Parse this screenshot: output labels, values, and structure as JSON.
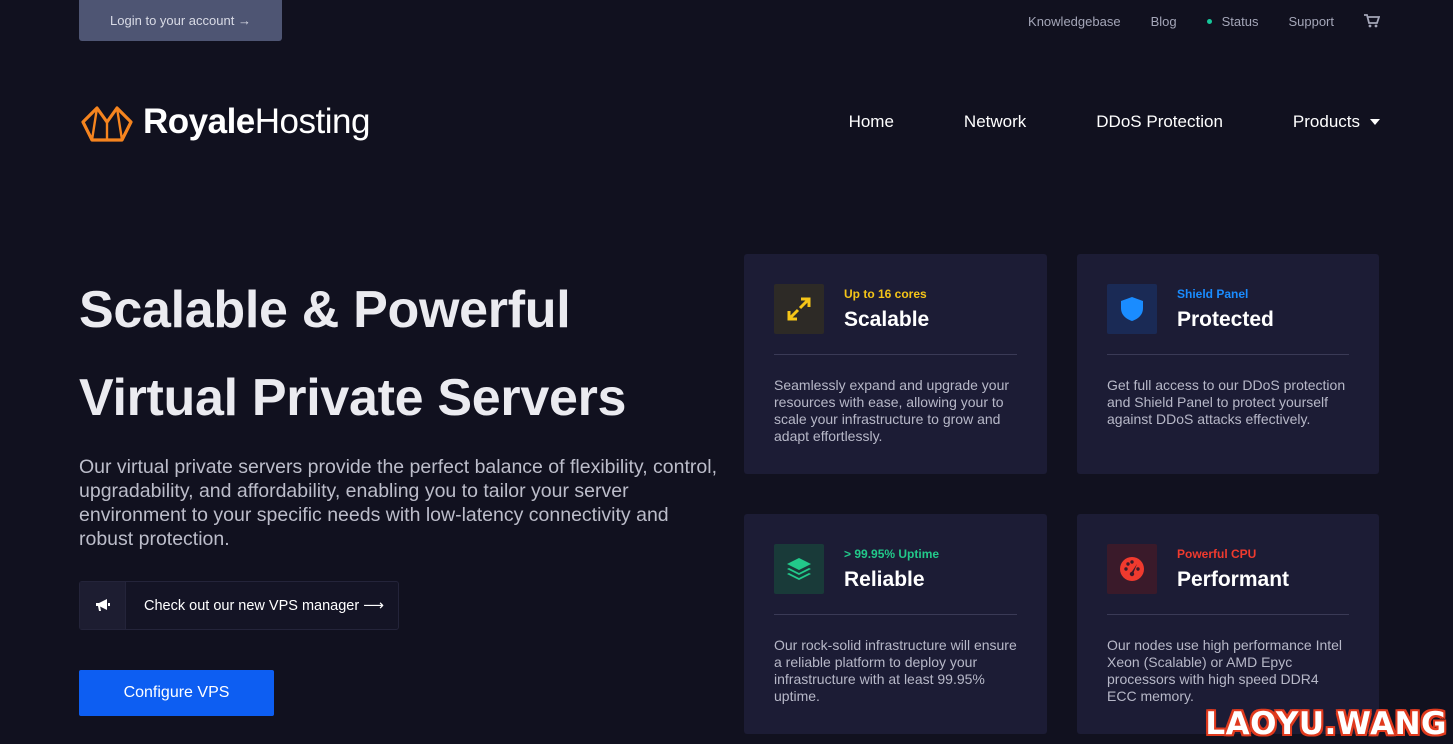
{
  "top_bar": {
    "login_label": "Login to your account →",
    "links": [
      "Knowledgebase",
      "Blog",
      "Status",
      "Support"
    ],
    "status_color": "#16c79a",
    "cart_icon": "cart-icon"
  },
  "header": {
    "logo_bold": "Royale",
    "logo_regular": "Hosting",
    "logo_icon": "crown-logo",
    "brand_color": "#f5841f",
    "nav": [
      "Home",
      "Network",
      "DDoS Protection",
      "Products"
    ]
  },
  "hero": {
    "title_line1": "Scalable & Powerful",
    "title_line2": "Virtual Private Servers",
    "description": "Our virtual private servers provide the perfect balance of flexibility, control, upgradability, and affordability, enabling you to tailor your server environment to your specific needs with low-latency connectivity and robust protection.",
    "vps_manager_label": "Check out our new VPS manager ⟶",
    "configure_label": "Configure VPS",
    "accent_color": "#0d5ef2"
  },
  "cards": [
    {
      "kicker": "Up to 16 cores",
      "heading": "Scalable",
      "body": "Seamlessly expand and upgrade your resources with ease, allowing your to scale your infrastructure to grow and adapt effortlessly.",
      "color": "#f5c518",
      "icon": "expand-arrows-icon"
    },
    {
      "kicker": "Shield Panel",
      "heading": "Protected",
      "body": "Get full access to our DDoS protection and Shield Panel to protect yourself against DDoS attacks effectively.",
      "color": "#1a8cff",
      "icon": "shield-icon"
    },
    {
      "kicker": "> 99.95% Uptime",
      "heading": "Reliable",
      "body": "Our rock-solid infrastructure will ensure a reliable platform to deploy your infrastructure with at least 99.95% uptime.",
      "color": "#22c98a",
      "icon": "layers-icon"
    },
    {
      "kicker": "Powerful CPU",
      "heading": "Performant",
      "body": "Our nodes use high performance Intel Xeon (Scalable) or AMD Epyc processors with high speed DDR4 ECC memory.",
      "color": "#f03a2e",
      "icon": "gauge-icon"
    }
  ],
  "watermark": "LAOYU.WANG"
}
